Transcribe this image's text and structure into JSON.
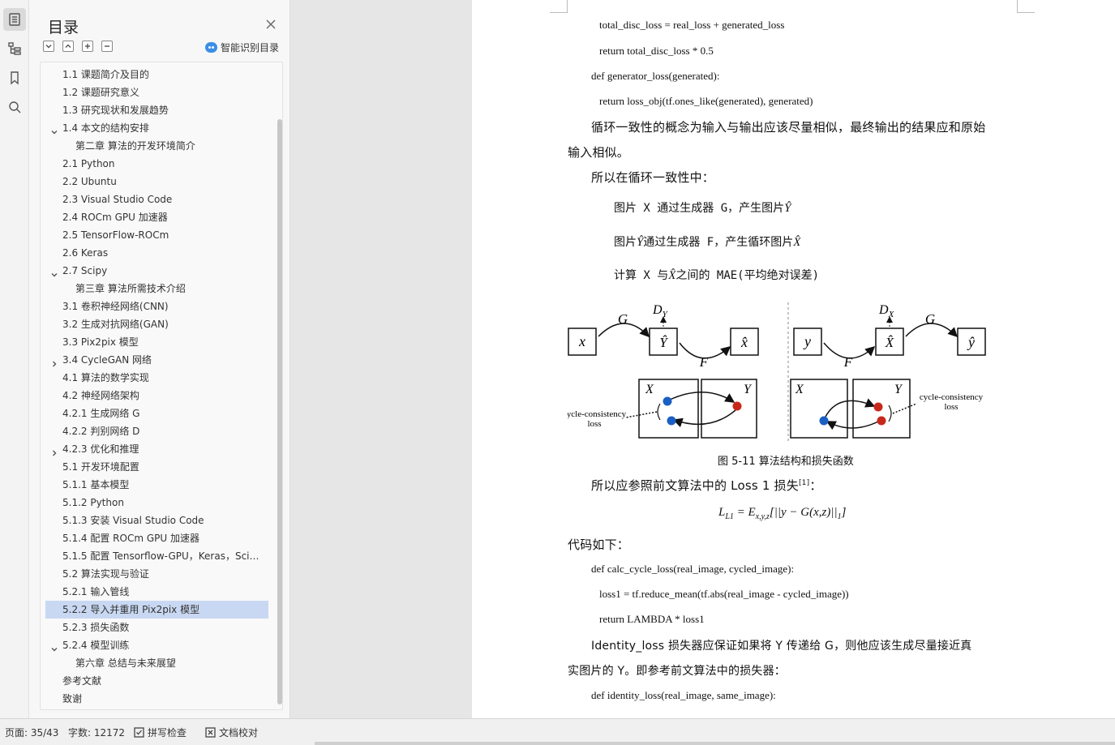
{
  "toc": {
    "title": "目录",
    "smart_label": "智能识别目录",
    "items": [
      {
        "text": "1.1  课题简介及目的",
        "level": 1,
        "chevron": ""
      },
      {
        "text": "1.2  课题研究意义",
        "level": 1,
        "chevron": ""
      },
      {
        "text": "1.3  研究现状和发展趋势",
        "level": 1,
        "chevron": ""
      },
      {
        "text": "1.4  本文的结构安排",
        "level": 1,
        "chevron": "down"
      },
      {
        "text": "第二章  算法的开发环境简介",
        "level": 0,
        "chevron": ""
      },
      {
        "text": "2.1 Python",
        "level": 1,
        "chevron": ""
      },
      {
        "text": "2.2 Ubuntu",
        "level": 1,
        "chevron": ""
      },
      {
        "text": "2.3 Visual Studio Code",
        "level": 1,
        "chevron": ""
      },
      {
        "text": "2.4 ROCm GPU 加速器",
        "level": 1,
        "chevron": ""
      },
      {
        "text": "2.5 TensorFlow-ROCm",
        "level": 1,
        "chevron": ""
      },
      {
        "text": "2.6 Keras",
        "level": 1,
        "chevron": ""
      },
      {
        "text": "2.7 Scipy",
        "level": 1,
        "chevron": "down"
      },
      {
        "text": "第三章  算法所需技术介绍",
        "level": 0,
        "chevron": ""
      },
      {
        "text": "3.1  卷积神经网络(CNN)",
        "level": 1,
        "chevron": ""
      },
      {
        "text": "3.2  生成对抗网络(GAN)",
        "level": 1,
        "chevron": ""
      },
      {
        "text": "3.3 Pix2pix 模型",
        "level": 1,
        "chevron": ""
      },
      {
        "text": "3.4 CycleGAN 网络",
        "level": 1,
        "chevron": "right"
      },
      {
        "text": "4.1  算法的数学实现",
        "level": 1,
        "chevron": ""
      },
      {
        "text": "4.2  神经网络架构",
        "level": 1,
        "chevron": ""
      },
      {
        "text": "4.2.1  生成网络 G",
        "level": 1,
        "chevron": ""
      },
      {
        "text": "4.2.2  判别网络  D",
        "level": 1,
        "chevron": ""
      },
      {
        "text": "4.2.3  优化和推理",
        "level": 1,
        "chevron": "right"
      },
      {
        "text": "5.1  开发环境配置",
        "level": 1,
        "chevron": ""
      },
      {
        "text": "5.1.1  基本模型",
        "level": 1,
        "chevron": ""
      },
      {
        "text": "5.1.2 Python",
        "level": 1,
        "chevron": ""
      },
      {
        "text": "5.1.3  安装 Visual Studio Code",
        "level": 1,
        "chevron": ""
      },
      {
        "text": "5.1.4  配置 ROCm GPU 加速器",
        "level": 1,
        "chevron": ""
      },
      {
        "text": "5.1.5  配置 Tensorflow-GPU，Keras，Scipy 环境",
        "level": 1,
        "chevron": ""
      },
      {
        "text": "5.2  算法实现与验证",
        "level": 1,
        "chevron": ""
      },
      {
        "text": "5.2.1  输入管线",
        "level": 1,
        "chevron": ""
      },
      {
        "text": "5.2.2  导入并重用  Pix2pix  模型",
        "level": 1,
        "chevron": "",
        "selected": true
      },
      {
        "text": "5.2.3  损失函数",
        "level": 1,
        "chevron": ""
      },
      {
        "text": "5.2.4  模型训练",
        "level": 1,
        "chevron": "down"
      },
      {
        "text": "第六章  总结与未来展望",
        "level": 0,
        "chevron": ""
      },
      {
        "text": "参考文献",
        "level": 1,
        "chevron": ""
      },
      {
        "text": "致谢",
        "level": 1,
        "chevron": ""
      }
    ]
  },
  "doc": {
    "code1": "total_disc_loss = real_loss + generated_loss",
    "code2": "return total_disc_loss * 0.5",
    "code3": "def generator_loss(generated):",
    "code4": "return loss_obj(tf.ones_like(generated), generated)",
    "para1a": "循环一致性的概念为输入与输出应该尽量相似，最终输出的结果应和原始",
    "para1b": "输入相似。",
    "para2": "所以在循环一致性中：",
    "step1": "图片 X 通过生成器 G，产生图片",
    "step1_sym": "Ŷ",
    "step2a": "图片",
    "step2_sym": "Ŷ",
    "step2b": "通过生成器 F，产生循环图片",
    "step2_sym2": "X̂",
    "step3a": "计算 X 与",
    "step3_sym": "X̂",
    "step3b": "之间的 MAE(平均绝对误差)",
    "figure": {
      "x": "x",
      "yhat": "Ŷ",
      "xhat": "x̂",
      "G": "G",
      "F": "F",
      "DY": "D",
      "DY_sub": "Y",
      "y": "y",
      "Xhat": "X̂",
      "yhat2": "ŷ",
      "DX": "D",
      "DX_sub": "X",
      "X": "X",
      "Y": "Y",
      "cc1": "cycle-consistency",
      "cc2": "loss"
    },
    "caption": "图 5-11  算法结构和损失函数",
    "para3a": "所以应参照前文算法中的 Loss 1 损失",
    "para3_ref": "[1]",
    "para3b": "：",
    "formula": "L",
    "formula_sub": "L1",
    "formula_rest": " = E",
    "formula_sub2": "x,y,z",
    "formula_tail": "[||y − G(x,z)||",
    "formula_sub3": "1",
    "formula_end": "]",
    "para4": "代码如下：",
    "code5": "def calc_cycle_loss(real_image, cycled_image):",
    "code6": "loss1 = tf.reduce_mean(tf.abs(real_image - cycled_image))",
    "code7": "return LAMBDA * loss1",
    "para5a": "Identity_loss 损失器应保证如果将 Y 传递给 G，则他应该生成尽量接近真",
    "para5b": "实图片的 Y。即参考前文算法中的损失器：",
    "code8": "def identity_loss(real_image, same_image):"
  },
  "status": {
    "page": "页面: 35/43",
    "words": "字数: 12172",
    "spell": "拼写检查",
    "proof": "文档校对"
  }
}
